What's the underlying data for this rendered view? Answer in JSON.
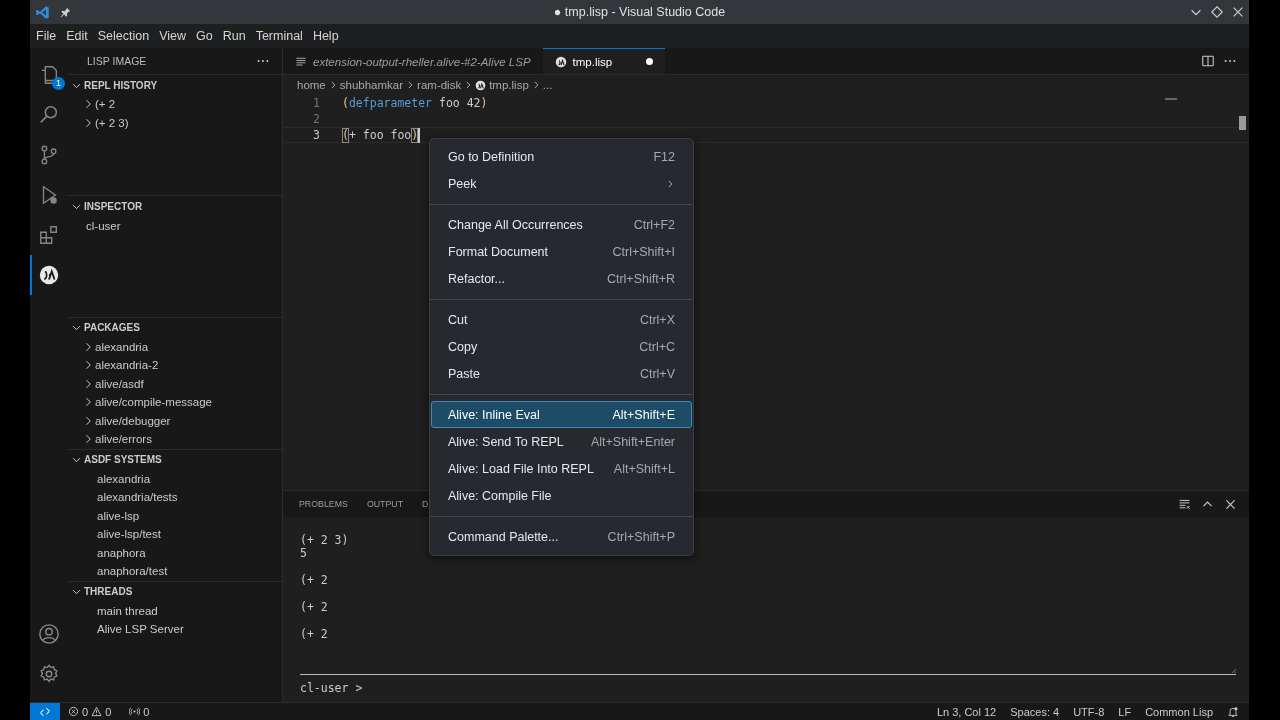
{
  "title_bar": {
    "title": "● tmp.lisp - Visual Studio Code"
  },
  "menu_bar": [
    "File",
    "Edit",
    "Selection",
    "View",
    "Go",
    "Run",
    "Terminal",
    "Help"
  ],
  "activity_bar": {
    "items": [
      {
        "kind": "explorer",
        "badge": "1",
        "selected": false
      },
      {
        "kind": "search",
        "selected": false
      },
      {
        "kind": "source-control",
        "selected": false
      },
      {
        "kind": "run-debug",
        "selected": false
      },
      {
        "kind": "extensions",
        "selected": false
      },
      {
        "kind": "alive",
        "selected": true
      }
    ],
    "bottom": [
      {
        "kind": "account"
      },
      {
        "kind": "settings"
      }
    ]
  },
  "sidebar": {
    "title": "LISP IMAGE",
    "sections": [
      {
        "title": "REPL HISTORY",
        "kind": "tree",
        "expanded": true,
        "items": [
          {
            "label": "(+ 2",
            "expanded": false
          },
          {
            "label": "(+ 2 3)",
            "expanded": false
          }
        ]
      },
      {
        "title": "INSPECTOR",
        "kind": "plain",
        "expanded": true,
        "items": [
          {
            "label": "cl-user"
          }
        ]
      },
      {
        "title": "PACKAGES",
        "kind": "tree",
        "expanded": true,
        "items": [
          {
            "label": "alexandria",
            "expanded": false
          },
          {
            "label": "alexandria-2",
            "expanded": false
          },
          {
            "label": "alive/asdf",
            "expanded": false
          },
          {
            "label": "alive/compile-message",
            "expanded": false
          },
          {
            "label": "alive/debugger",
            "expanded": false
          },
          {
            "label": "alive/errors",
            "expanded": false
          }
        ]
      },
      {
        "title": "ASDF SYSTEMS",
        "kind": "tree",
        "expanded": true,
        "items": [
          {
            "label": "alexandria"
          },
          {
            "label": "alexandria/tests"
          },
          {
            "label": "alive-lsp"
          },
          {
            "label": "alive-lsp/test"
          },
          {
            "label": "anaphora"
          },
          {
            "label": "anaphora/test"
          }
        ]
      },
      {
        "title": "THREADS",
        "kind": "tree",
        "expanded": true,
        "items": [
          {
            "label": "main thread"
          },
          {
            "label": "Alive LSP Server"
          }
        ]
      }
    ]
  },
  "editor": {
    "tabs": [
      {
        "label": "extension-output-rheller.alive-#2-Alive LSP",
        "kind": "output",
        "preview": true,
        "selected": false,
        "modified": false
      },
      {
        "label": "tmp.lisp",
        "kind": "lisp",
        "preview": false,
        "selected": true,
        "modified": true
      }
    ],
    "breadcrumb": [
      {
        "label": "home",
        "kind": "folder"
      },
      {
        "label": "shubhamkar",
        "kind": "folder"
      },
      {
        "label": "ram-disk",
        "kind": "folder"
      },
      {
        "label": "tmp.lisp",
        "kind": "lisp"
      },
      {
        "label": "...",
        "kind": "more"
      }
    ],
    "lines": [
      {
        "number": "1",
        "current": false,
        "tokens": [
          {
            "text": "(",
            "kind": "paren"
          },
          {
            "text": "defparameter",
            "kind": "keyword"
          },
          {
            "text": " foo 42",
            "kind": "plain"
          },
          {
            "text": ")",
            "kind": "paren"
          }
        ]
      },
      {
        "number": "2",
        "current": false
      },
      {
        "number": "3",
        "current": true,
        "tokens": [
          {
            "text": "(",
            "kind": "paren",
            "matched": true
          },
          {
            "text": "+ foo foo",
            "kind": "plain"
          },
          {
            "text": ")",
            "kind": "paren",
            "matched": true
          }
        ]
      }
    ]
  },
  "panel": {
    "tabs": [
      {
        "label": "PROBLEMS",
        "selected": false
      },
      {
        "label": "OUTPUT",
        "selected": false
      },
      {
        "label": "D",
        "selected": false
      }
    ],
    "output": [
      {
        "lines": [
          "(+ 2 3)",
          "5"
        ]
      },
      {
        "lines": [
          "(+ 2"
        ]
      },
      {
        "lines": [
          "(+ 2"
        ]
      },
      {
        "lines": [
          "(+ 2"
        ]
      }
    ],
    "prompt": "cl-user >"
  },
  "context_menu": {
    "groups": [
      {
        "items": [
          {
            "label": "Go to Definition",
            "shortcut": "F12",
            "selected": false
          },
          {
            "label": "Peek",
            "submenu": true,
            "selected": false
          }
        ]
      },
      {
        "items": [
          {
            "label": "Change All Occurrences",
            "shortcut": "Ctrl+F2",
            "selected": false
          },
          {
            "label": "Format Document",
            "shortcut": "Ctrl+Shift+I",
            "selected": false
          },
          {
            "label": "Refactor...",
            "shortcut": "Ctrl+Shift+R",
            "selected": false
          }
        ]
      },
      {
        "items": [
          {
            "label": "Cut",
            "shortcut": "Ctrl+X",
            "selected": false
          },
          {
            "label": "Copy",
            "shortcut": "Ctrl+C",
            "selected": false
          },
          {
            "label": "Paste",
            "shortcut": "Ctrl+V",
            "selected": false
          }
        ]
      },
      {
        "items": [
          {
            "label": "Alive: Inline Eval",
            "shortcut": "Alt+Shift+E",
            "selected": true
          },
          {
            "label": "Alive: Send To REPL",
            "shortcut": "Alt+Shift+Enter",
            "selected": false
          },
          {
            "label": "Alive: Load File Into REPL",
            "shortcut": "Alt+Shift+L",
            "selected": false
          },
          {
            "label": "Alive: Compile File",
            "selected": false
          }
        ]
      },
      {
        "items": [
          {
            "label": "Command Palette...",
            "shortcut": "Ctrl+Shift+P",
            "selected": false
          }
        ]
      }
    ]
  },
  "status_bar": {
    "errors": "0",
    "warnings": "0",
    "ports": "0",
    "items": [
      "Ln 3, Col 12",
      "Spaces: 4",
      "UTF-8",
      "LF",
      "Common Lisp"
    ]
  }
}
